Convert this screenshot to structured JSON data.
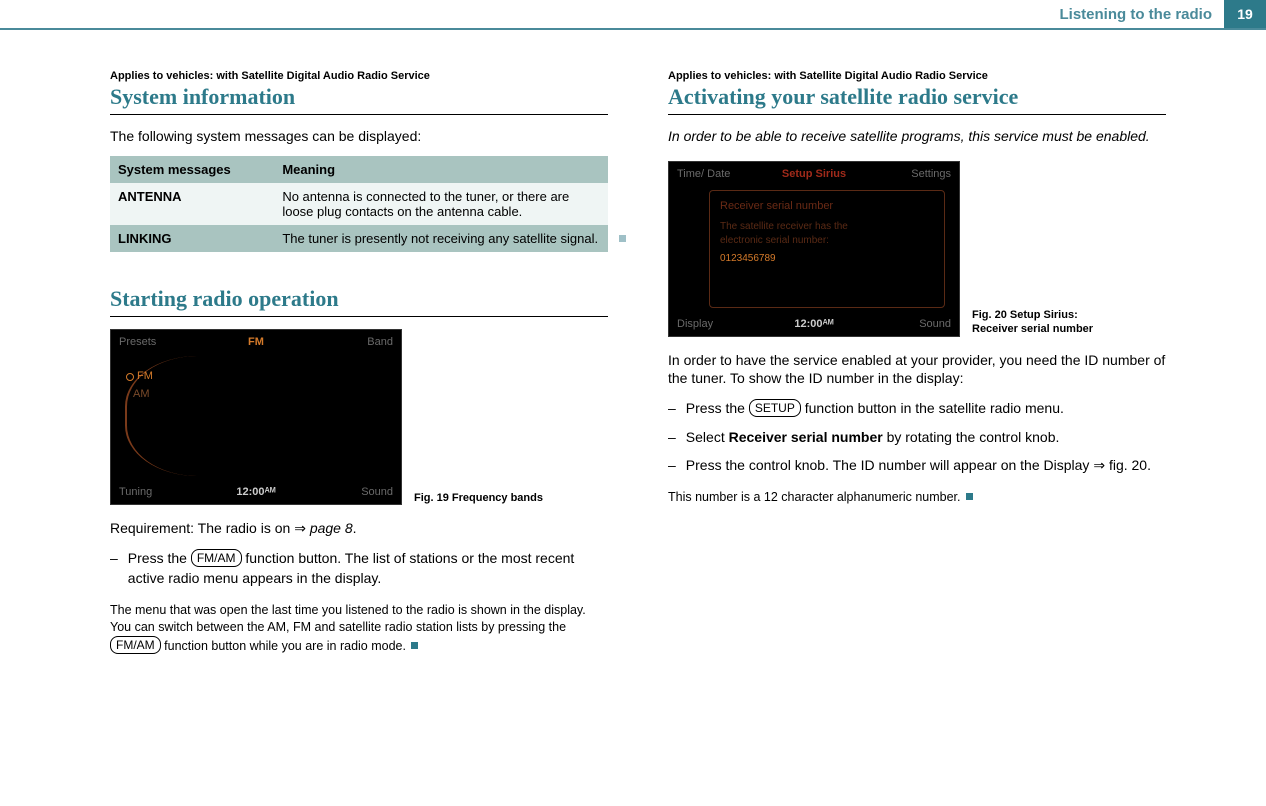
{
  "chapterTitle": "Listening to the radio",
  "pageNumber": "19",
  "left": {
    "appliesTo": "Applies to vehicles: with Satellite Digital Audio Radio Service",
    "heading1": "System information",
    "introText": "The following system messages can be displayed:",
    "table": {
      "header": {
        "c1": "System mes­sages",
        "c2": "Meaning"
      },
      "rows": [
        {
          "c1": "ANTENNA",
          "c2": "No antenna is connected to the tuner, or there are loose plug contacts on the antenna cable."
        },
        {
          "c1": "LINKING",
          "c2": "The tuner is presently not receiving any satellite signal."
        }
      ]
    },
    "heading2": "Starting radio operation",
    "fig19": {
      "topLeft": "Presets",
      "topCenter": "FM",
      "topRight": "Band",
      "optFM": "FM",
      "optAM": "AM",
      "bottomLeft": "Tuning",
      "bottomCenter": "12:00ᴬᴹ",
      "bottomRight": "Sound",
      "caption": "Fig. 19   Frequency bands"
    },
    "requirementText1": "Requirement: The radio is on ",
    "requirementLink": "page 8",
    "period": ".",
    "step1_pre": "Press the ",
    "step1_btn": "FM/AM",
    "step1_post": " function button. The list of stations or the most recent active radio menu appears in the display.",
    "note_pre": "The menu that was open the last time you listened to the radio is shown in the display. You can switch between the AM, FM and satel­lite radio station lists by pressing the ",
    "note_btn": "FM/AM",
    "note_post": " function button while you are in radio mode."
  },
  "right": {
    "appliesTo": "Applies to vehicles: with Satellite Digital Audio Radio Service",
    "heading": "Activating your satellite radio service",
    "leadItalic": "In order to be able to receive satellite programs, this service must be enabled.",
    "fig20": {
      "topLeft": "Time/ Date",
      "topCenter": "Setup Sirius",
      "topRight": "Settings",
      "boxTitle": "Receiver serial number",
      "boxLine1": "The satellite receiver has the",
      "boxLine2": "electronic serial number:",
      "boxSerial": "0123456789",
      "bottomLeft": "Display",
      "bottomCenter": "12:00ᴬᴹ",
      "bottomRight": "Sound",
      "caption": "Fig. 20   Setup Sirius: Receiver serial number"
    },
    "midText": "In order to have the service enabled at your provider, you need the ID number of the tuner. To show the ID number in the display:",
    "step1_pre": "Press the ",
    "step1_btn": "SETUP",
    "step1_post": " function button in the satellite radio menu.",
    "step2_pre": "Select ",
    "step2_bold": "Receiver serial number",
    "step2_post": " by rotating the control knob.",
    "step3_pre": "Press the control knob. The ID number will appear on the Display ",
    "step3_fig": "fig. 20.",
    "footnote": "This number is a 12 character alphanumeric number."
  },
  "arrow": "⇒"
}
